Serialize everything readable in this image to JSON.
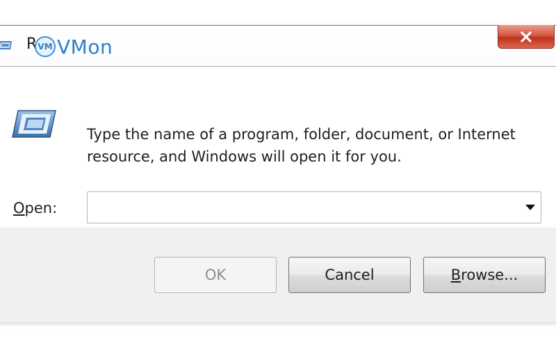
{
  "window": {
    "title_visible": "R",
    "watermark_badge": "VM",
    "watermark_text": "VMon",
    "close_glyph": "x"
  },
  "icons": {
    "title": "run-dialog-icon",
    "body": "run-dialog-icon",
    "close": "close-icon",
    "dropdown": "chevron-down-icon"
  },
  "dialog": {
    "line1": "Type the name of a program, folder, document, or Internet",
    "line2": "resource, and Windows will open it for you.",
    "open_label_accel": "O",
    "open_label_rest": "pen:",
    "open_value": "",
    "open_placeholder": ""
  },
  "buttons": {
    "ok": "OK",
    "cancel": "Cancel",
    "browse_accel": "B",
    "browse_rest": "rowse..."
  },
  "colors": {
    "close_button": "#c7402a",
    "watermark": "#2f7fc6",
    "footer_bg": "#f0f0f0",
    "combo_border": "#a9b8c9"
  }
}
